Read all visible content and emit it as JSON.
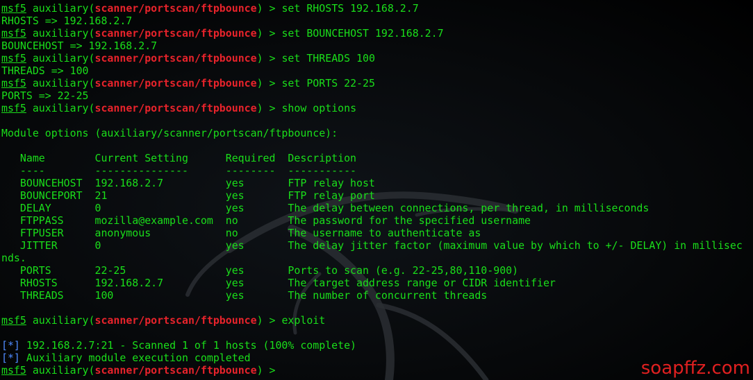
{
  "prompt": {
    "name": "msf5",
    "prefix": " auxiliary(",
    "module": "scanner/portscan/ftpbounce",
    "suffix": ") > "
  },
  "lines": [
    {
      "type": "prompt",
      "command": "set RHOSTS 192.168.2.7"
    },
    {
      "type": "output",
      "text": "RHOSTS => 192.168.2.7"
    },
    {
      "type": "prompt",
      "command": "set BOUNCEHOST 192.168.2.7"
    },
    {
      "type": "output",
      "text": "BOUNCEHOST => 192.168.2.7"
    },
    {
      "type": "prompt",
      "command": "set THREADS 100"
    },
    {
      "type": "output",
      "text": "THREADS => 100"
    },
    {
      "type": "prompt",
      "command": "set PORTS 22-25"
    },
    {
      "type": "output",
      "text": "PORTS => 22-25"
    },
    {
      "type": "prompt",
      "command": "show options"
    },
    {
      "type": "output",
      "text": ""
    },
    {
      "type": "output",
      "text": "Module options (auxiliary/scanner/portscan/ftpbounce):"
    },
    {
      "type": "output",
      "text": ""
    },
    {
      "type": "output",
      "text": "   Name        Current Setting      Required  Description"
    },
    {
      "type": "output",
      "text": "   ----        ---------------      --------  -----------"
    },
    {
      "type": "output",
      "text": "   BOUNCEHOST  192.168.2.7          yes       FTP relay host"
    },
    {
      "type": "output",
      "text": "   BOUNCEPORT  21                   yes       FTP relay port"
    },
    {
      "type": "output",
      "text": "   DELAY       0                    yes       The delay between connections, per thread, in milliseconds"
    },
    {
      "type": "output",
      "text": "   FTPPASS     mozilla@example.com  no        The password for the specified username"
    },
    {
      "type": "output",
      "text": "   FTPUSER     anonymous            no        The username to authenticate as"
    },
    {
      "type": "output",
      "text": "   JITTER      0                    yes       The delay jitter factor (maximum value by which to +/- DELAY) in millisec"
    },
    {
      "type": "output",
      "text": "nds."
    },
    {
      "type": "output",
      "text": "   PORTS       22-25                yes       Ports to scan (e.g. 22-25,80,110-900)"
    },
    {
      "type": "output",
      "text": "   RHOSTS      192.168.2.7          yes       The target address range or CIDR identifier"
    },
    {
      "type": "output",
      "text": "   THREADS     100                  yes       The number of concurrent threads"
    },
    {
      "type": "output",
      "text": ""
    },
    {
      "type": "prompt",
      "command": "exploit"
    },
    {
      "type": "output",
      "text": ""
    },
    {
      "type": "status",
      "mark": "[*]",
      "text": " 192.168.2.7:21 - Scanned 1 of 1 hosts (100% complete)"
    },
    {
      "type": "status",
      "mark": "[*]",
      "text": " Auxiliary module execution completed"
    },
    {
      "type": "prompt",
      "command": ""
    }
  ],
  "watermark": "soapffz.com",
  "colors": {
    "text": "#1adf1a",
    "module": "#e8232b",
    "status_mark": "#4f8bff",
    "watermark": "#e02020",
    "background": "#000000"
  },
  "icons": {
    "background_logo": "kali-dragon-icon"
  }
}
